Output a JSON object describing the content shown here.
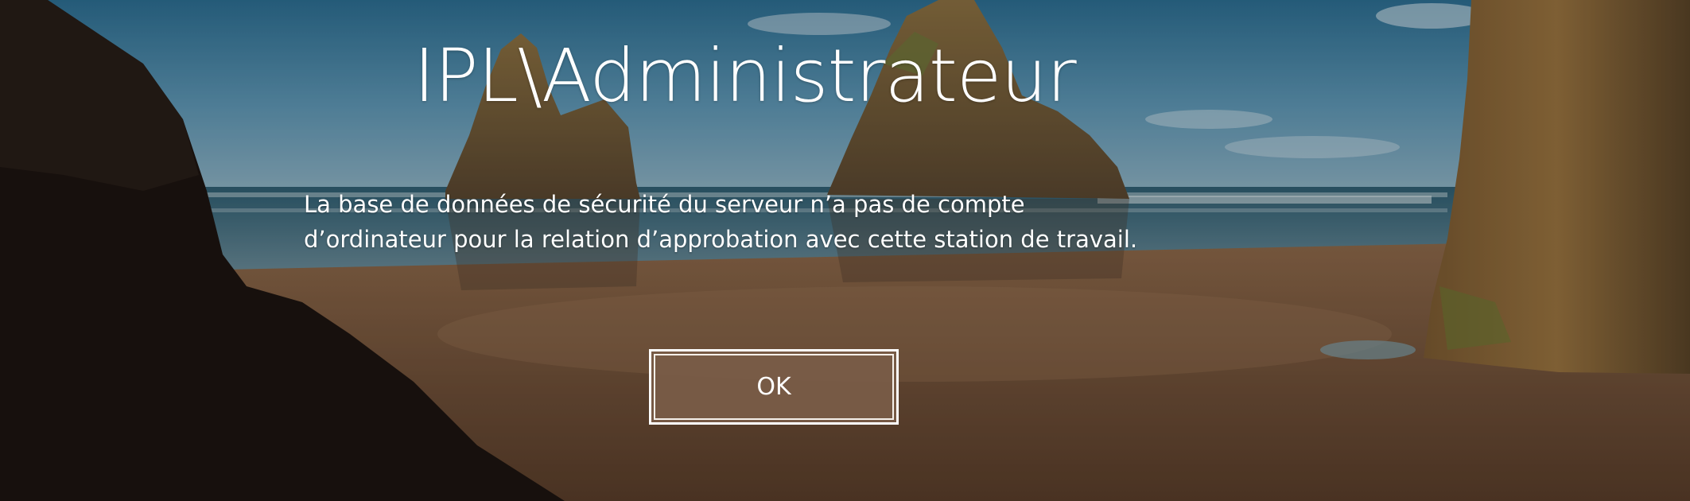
{
  "login_error": {
    "account_name": "IPL\\Administrateur",
    "message_lines": [
      "La base de données de sécurité du serveur n’a pas de compte",
      "d’ordinateur pour la relation d’approbation avec cette station de travail."
    ],
    "ok_label": "OK"
  }
}
